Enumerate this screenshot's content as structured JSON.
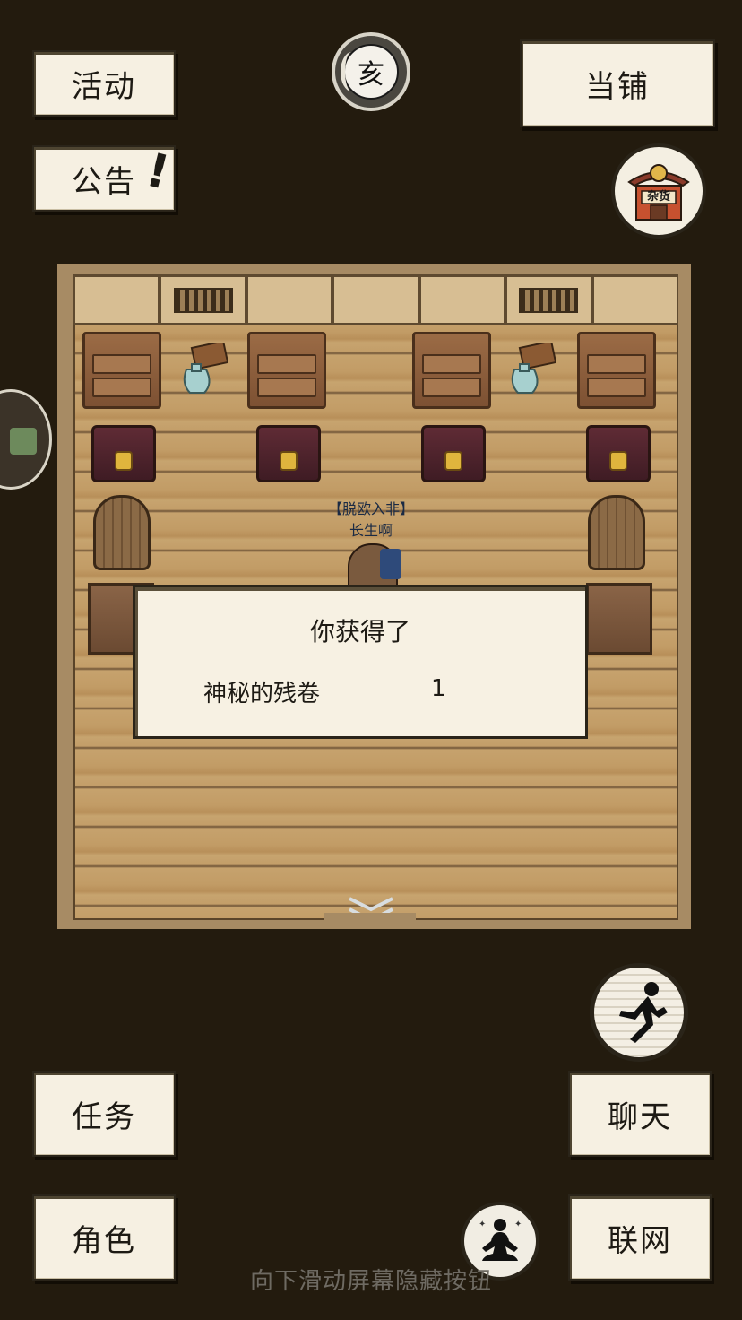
{
  "top_buttons": {
    "activity": "活动",
    "notice": "公告",
    "notice_mark": "!",
    "pawnshop": "当铺"
  },
  "time_badge": {
    "glyph": "亥",
    "icon": "moon-time-icon"
  },
  "shop_badge": {
    "label": "杂货",
    "icon": "general-store-icon"
  },
  "room": {
    "player_title": "【脱欧入非】",
    "player_name": "长生啊",
    "expand_icon": "double-chevron-down-icon"
  },
  "popup": {
    "title": "你获得了",
    "item_name": "神秘的残卷",
    "item_count": "1"
  },
  "bottom_buttons": {
    "tasks": "任务",
    "character": "角色",
    "chat": "聊天",
    "network": "联网"
  },
  "action_icons": {
    "run": "running-man-icon",
    "meditate": "meditation-icon"
  },
  "hint": "向下滑动屏幕隐藏按钮",
  "colors": {
    "background": "#231b0e",
    "paper": "#f6f0e2",
    "floor": "#c29c66"
  }
}
